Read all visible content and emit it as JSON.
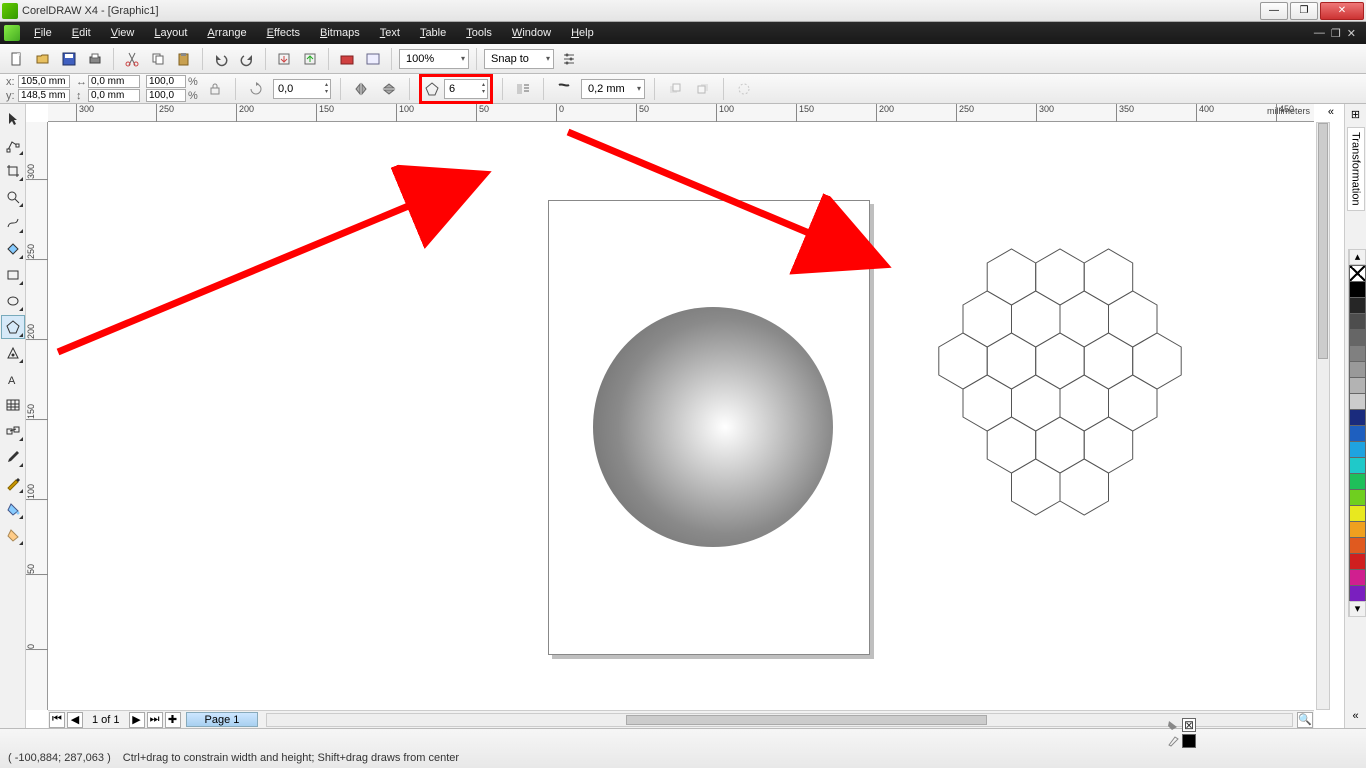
{
  "app": {
    "title": "CorelDRAW X4 - [Graphic1]"
  },
  "menus": [
    "File",
    "Edit",
    "View",
    "Layout",
    "Arrange",
    "Effects",
    "Bitmaps",
    "Text",
    "Table",
    "Tools",
    "Window",
    "Help"
  ],
  "toolbar1": {
    "zoom": "100%",
    "snap": "Snap to"
  },
  "propbar": {
    "x": "105,0 mm",
    "y": "148,5 mm",
    "w": "0,0 mm",
    "h": "0,0 mm",
    "scale_x": "100,0",
    "scale_y": "100,0",
    "rotation": "0,0",
    "sides": "6",
    "outline": "0,2 mm"
  },
  "ruler": {
    "unit": "millimeters",
    "h_ticks": [
      {
        "p": 28,
        "l": "300"
      },
      {
        "p": 108,
        "l": "250"
      },
      {
        "p": 188,
        "l": "200"
      },
      {
        "p": 268,
        "l": "150"
      },
      {
        "p": 348,
        "l": "100"
      },
      {
        "p": 428,
        "l": "50"
      },
      {
        "p": 508,
        "l": "0"
      },
      {
        "p": 588,
        "l": "50"
      },
      {
        "p": 668,
        "l": "100"
      },
      {
        "p": 748,
        "l": "150"
      },
      {
        "p": 828,
        "l": "200"
      },
      {
        "p": 908,
        "l": "250"
      },
      {
        "p": 988,
        "l": "300"
      },
      {
        "p": 1068,
        "l": "350"
      },
      {
        "p": 1148,
        "l": "400"
      },
      {
        "p": 1228,
        "l": "450"
      }
    ],
    "v_ticks": [
      {
        "p": 40,
        "l": "300"
      },
      {
        "p": 120,
        "l": "250"
      },
      {
        "p": 200,
        "l": "200"
      },
      {
        "p": 280,
        "l": "150"
      },
      {
        "p": 360,
        "l": "100"
      },
      {
        "p": 440,
        "l": "50"
      },
      {
        "p": 520,
        "l": "0"
      }
    ]
  },
  "pages": {
    "counter": "1 of 1",
    "tab": "Page 1"
  },
  "status": {
    "coords": "( -100,884; 287,063 )",
    "hint": "Ctrl+drag to constrain width and height; Shift+drag draws from center"
  },
  "docker": {
    "label": "Transformation"
  },
  "palette": [
    "#000000",
    "#262626",
    "#4d4d4d",
    "#666666",
    "#808080",
    "#999999",
    "#b3b3b3",
    "#cccccc",
    "#1a2b7d",
    "#1e5fbf",
    "#1fa3e0",
    "#1fc9c9",
    "#1fbf5a",
    "#6fcf1f",
    "#e8e81f",
    "#f0a01f",
    "#e05a1f",
    "#d01f1f",
    "#d01f8f",
    "#7a1fbf"
  ]
}
